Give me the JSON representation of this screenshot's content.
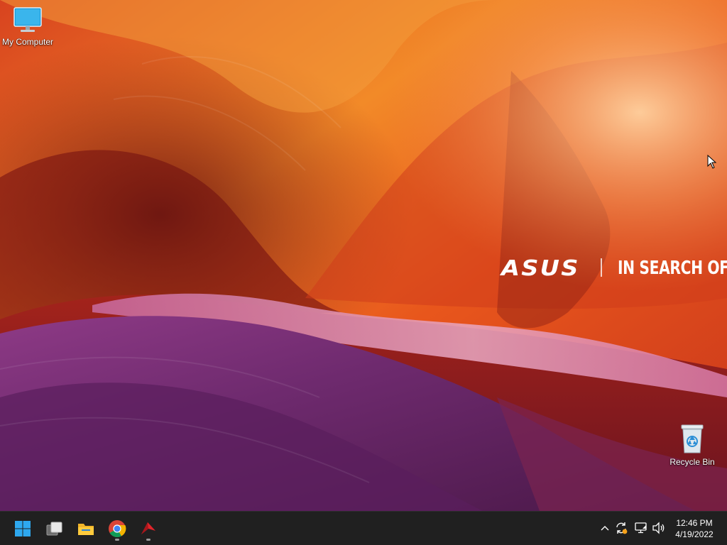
{
  "desktop": {
    "icons": [
      {
        "label": "My Computer",
        "icon": "monitor-icon"
      },
      {
        "label": "Recycle Bin",
        "icon": "recycle-bin-icon"
      }
    ],
    "wallpaper": {
      "brand": "ASUS",
      "tagline": "IN SEARCH OF",
      "colors": {
        "orange": "#f07a1c",
        "red": "#b8301a",
        "purple": "#6e2a6e",
        "pink": "#d87aa8"
      }
    }
  },
  "taskbar": {
    "background": "#202020",
    "pinned": [
      {
        "name": "start-button",
        "icon": "windows-logo-icon",
        "running": false
      },
      {
        "name": "task-view-button",
        "icon": "task-view-icon",
        "running": false
      },
      {
        "name": "file-explorer-button",
        "icon": "folder-icon",
        "running": false
      },
      {
        "name": "chrome-button",
        "icon": "chrome-icon",
        "running": true
      },
      {
        "name": "app-button",
        "icon": "red-arrow-app-icon",
        "running": true
      }
    ],
    "tray": {
      "icons": [
        "chevron-up-icon",
        "sync-icon",
        "network-icon",
        "volume-icon"
      ],
      "time": "12:46 PM",
      "date": "4/19/2022"
    }
  }
}
